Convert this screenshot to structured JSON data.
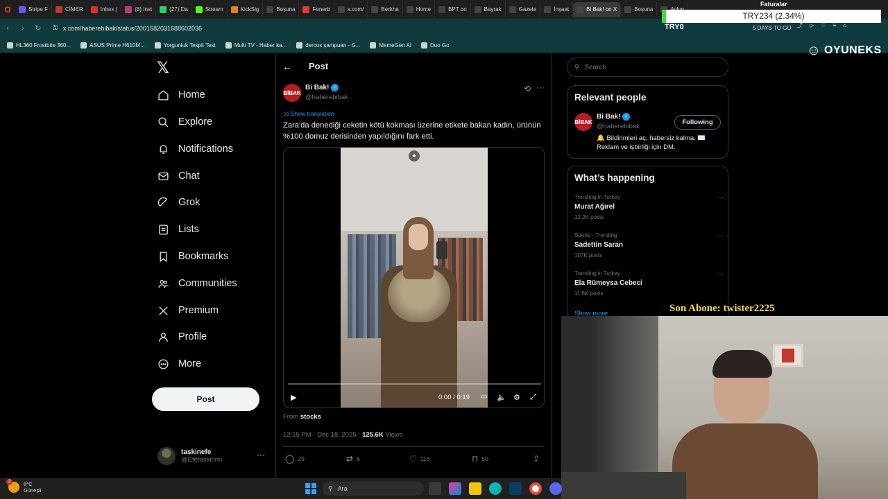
{
  "browser": {
    "tabs": [
      {
        "label": "Stripe F",
        "color": "#635bff"
      },
      {
        "label": "CİMER",
        "color": "#c0392b"
      },
      {
        "label": "Inbox (",
        "color": "#d93025"
      },
      {
        "label": "(8) Inst",
        "color": "#c13584"
      },
      {
        "label": "(27) Da",
        "color": "#25d366"
      },
      {
        "label": "Stream",
        "color": "#53fc18"
      },
      {
        "label": "KickSig",
        "color": "#e67e22"
      },
      {
        "label": "Boşuna",
        "color": "#444"
      },
      {
        "label": "Fenerb",
        "color": "#e53935"
      },
      {
        "label": "x.com/",
        "color": "#444"
      },
      {
        "label": "Berkha",
        "color": "#444"
      },
      {
        "label": "Home",
        "color": "#444"
      },
      {
        "label": "BPT on",
        "color": "#444"
      },
      {
        "label": "Bayrak",
        "color": "#444"
      },
      {
        "label": "Gazete",
        "color": "#444"
      },
      {
        "label": "İnşaat",
        "color": "#444"
      },
      {
        "label": "Bi Bak! on X",
        "color": "#444",
        "active": true
      },
      {
        "label": "Boşuna",
        "color": "#444"
      },
      {
        "label": "Aykın",
        "color": "#444"
      }
    ],
    "url": "x.com/haberebibak/status/2001582031688602036",
    "bookmarks": [
      "HL360 Frostbite 360...",
      "ASUS Prime H610M...",
      "Yorgunluk Tespit Test",
      "Multi TV - Haber ka...",
      "dercos şampuan - G...",
      "MemeGen AI",
      "Duo Go"
    ]
  },
  "stream_overlay": {
    "price_ticker": "TRY234 (2.34%)",
    "faturalar": "Faturalar",
    "try0": "TRY0",
    "days_to_go": "5 DAYS TO GO",
    "brand": "OYUNEKS",
    "sub_banner": "Son Abone: twister2225"
  },
  "nav": {
    "items": [
      {
        "label": "Home",
        "icon": "home-icon"
      },
      {
        "label": "Explore",
        "icon": "search-icon"
      },
      {
        "label": "Notifications",
        "icon": "bell-icon"
      },
      {
        "label": "Chat",
        "icon": "mail-icon"
      },
      {
        "label": "Grok",
        "icon": "grok-icon"
      },
      {
        "label": "Lists",
        "icon": "list-icon"
      },
      {
        "label": "Bookmarks",
        "icon": "bookmark-icon"
      },
      {
        "label": "Communities",
        "icon": "people-icon"
      },
      {
        "label": "Premium",
        "icon": "x-icon"
      },
      {
        "label": "Profile",
        "icon": "person-icon"
      },
      {
        "label": "More",
        "icon": "more-circle-icon"
      }
    ],
    "post_button": "Post",
    "account": {
      "name": "taskinefe",
      "handle": "@Efetaskinnn"
    }
  },
  "post": {
    "header_title": "Post",
    "author_name": "Bi Bak!",
    "author_handle": "@haberebibak",
    "avatar_text": "BİBAK",
    "show_translation": "Show translation",
    "text": "Zara'da denediği ceketin kötü kokması üzerine etikete bakan kadın, ürünün %100 domuz derisinden yapıldığını fark etti.",
    "video_time": "0:00 / 0:19",
    "video_progress": 0,
    "from_label": "From",
    "from_source": "stocks",
    "timestamp": "12:15 PM · Dec 18, 2025 · ",
    "views_count": "125.6K",
    "views_label": " Views",
    "replies": "29",
    "reposts": "6",
    "likes": "116",
    "bookmarks": "50"
  },
  "sidebar": {
    "search_placeholder": "Search",
    "relevant_title": "Relevant people",
    "person": {
      "name": "Bi Bak!",
      "handle": "@haberebibak",
      "follow_label": "Following",
      "bio": "🔔 Bildirimleri aç, habersiz kalma. ✉️ Reklam ve işbirliği için DM."
    },
    "happening_title": "What’s happening",
    "trends": [
      {
        "context": "Trending in Turkey",
        "name": "Murat Ağırel",
        "count": "12.2K posts"
      },
      {
        "context": "Sports · Trending",
        "name": "Sadettin Saran",
        "count": "107K posts"
      },
      {
        "context": "Trending in Turkey",
        "name": "Ela Rümeysa Cebeci",
        "count": "11.6K posts"
      }
    ],
    "show_more": "Show more"
  },
  "taskbar": {
    "weather_temp": "8°C",
    "weather_desc": "Güneşli",
    "weather_badge": "2",
    "search_placeholder": "Ara"
  }
}
